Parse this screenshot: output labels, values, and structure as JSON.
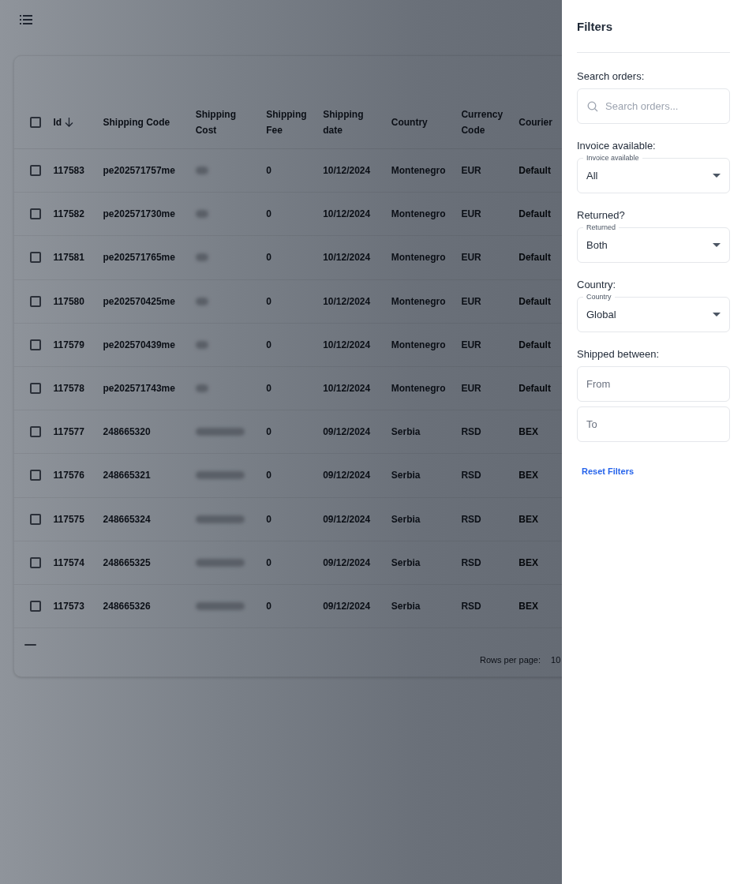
{
  "columns": [
    {
      "label": "Id",
      "sorted": true
    },
    {
      "label": "Shipping Code",
      "sorted": false
    },
    {
      "label": "Shipping Cost",
      "sorted": false
    },
    {
      "label": "Shipping Fee",
      "sorted": false
    },
    {
      "label": "Shipping date",
      "sorted": false
    },
    {
      "label": "Country",
      "sorted": false
    },
    {
      "label": "Currency Code",
      "sorted": false
    },
    {
      "label": "Courier",
      "sorted": false
    }
  ],
  "select_all": {
    "checked": false
  },
  "rows": [
    {
      "checked": false,
      "id": "117583",
      "code": "pe202571757me",
      "cost_redacted": true,
      "fee": "0",
      "date": "10/12/2024",
      "country": "Montenegro",
      "currency": "EUR",
      "courier": "Default"
    },
    {
      "checked": false,
      "id": "117582",
      "code": "pe202571730me",
      "cost_redacted": true,
      "fee": "0",
      "date": "10/12/2024",
      "country": "Montenegro",
      "currency": "EUR",
      "courier": "Default"
    },
    {
      "checked": false,
      "id": "117581",
      "code": "pe202571765me",
      "cost_redacted": true,
      "fee": "0",
      "date": "10/12/2024",
      "country": "Montenegro",
      "currency": "EUR",
      "courier": "Default"
    },
    {
      "checked": false,
      "id": "117580",
      "code": "pe202570425me",
      "cost_redacted": true,
      "fee": "0",
      "date": "10/12/2024",
      "country": "Montenegro",
      "currency": "EUR",
      "courier": "Default"
    },
    {
      "checked": false,
      "id": "117579",
      "code": "pe202570439me",
      "cost_redacted": true,
      "fee": "0",
      "date": "10/12/2024",
      "country": "Montenegro",
      "currency": "EUR",
      "courier": "Default"
    },
    {
      "checked": false,
      "id": "117578",
      "code": "pe202571743me",
      "cost_redacted": true,
      "fee": "0",
      "date": "10/12/2024",
      "country": "Montenegro",
      "currency": "EUR",
      "courier": "Default"
    },
    {
      "checked": false,
      "id": "117577",
      "code": "248665320",
      "cost_redacted": true,
      "fee": "0",
      "date": "09/12/2024",
      "country": "Serbia",
      "currency": "RSD",
      "courier": "BEX"
    },
    {
      "checked": false,
      "id": "117576",
      "code": "248665321",
      "cost_redacted": true,
      "fee": "0",
      "date": "09/12/2024",
      "country": "Serbia",
      "currency": "RSD",
      "courier": "BEX"
    },
    {
      "checked": false,
      "id": "117575",
      "code": "248665324",
      "cost_redacted": true,
      "fee": "0",
      "date": "09/12/2024",
      "country": "Serbia",
      "currency": "RSD",
      "courier": "BEX"
    },
    {
      "checked": false,
      "id": "117574",
      "code": "248665325",
      "cost_redacted": true,
      "fee": "0",
      "date": "09/12/2024",
      "country": "Serbia",
      "currency": "RSD",
      "courier": "BEX"
    },
    {
      "checked": false,
      "id": "117573",
      "code": "248665326",
      "cost_redacted": true,
      "fee": "0",
      "date": "09/12/2024",
      "country": "Serbia",
      "currency": "RSD",
      "courier": "BEX"
    }
  ],
  "pagination": {
    "rows_per_page_label": "Rows per page:",
    "rows_per_page": "10"
  },
  "filters": {
    "title": "Filters",
    "sections": [
      {
        "kind": "search",
        "label": "Search orders:",
        "placeholder": "Search orders..."
      },
      {
        "kind": "select",
        "label": "Invoice available:",
        "field_label": "Invoice available",
        "value": "All"
      },
      {
        "kind": "select",
        "label": "Returned?",
        "field_label": "Returned",
        "value": "Both"
      },
      {
        "kind": "select",
        "label": "Country:",
        "field_label": "Country",
        "value": "Global"
      },
      {
        "kind": "range",
        "label": "Shipped between:",
        "from_placeholder": "From",
        "to_placeholder": "To"
      }
    ],
    "reset": "Reset Filters"
  }
}
